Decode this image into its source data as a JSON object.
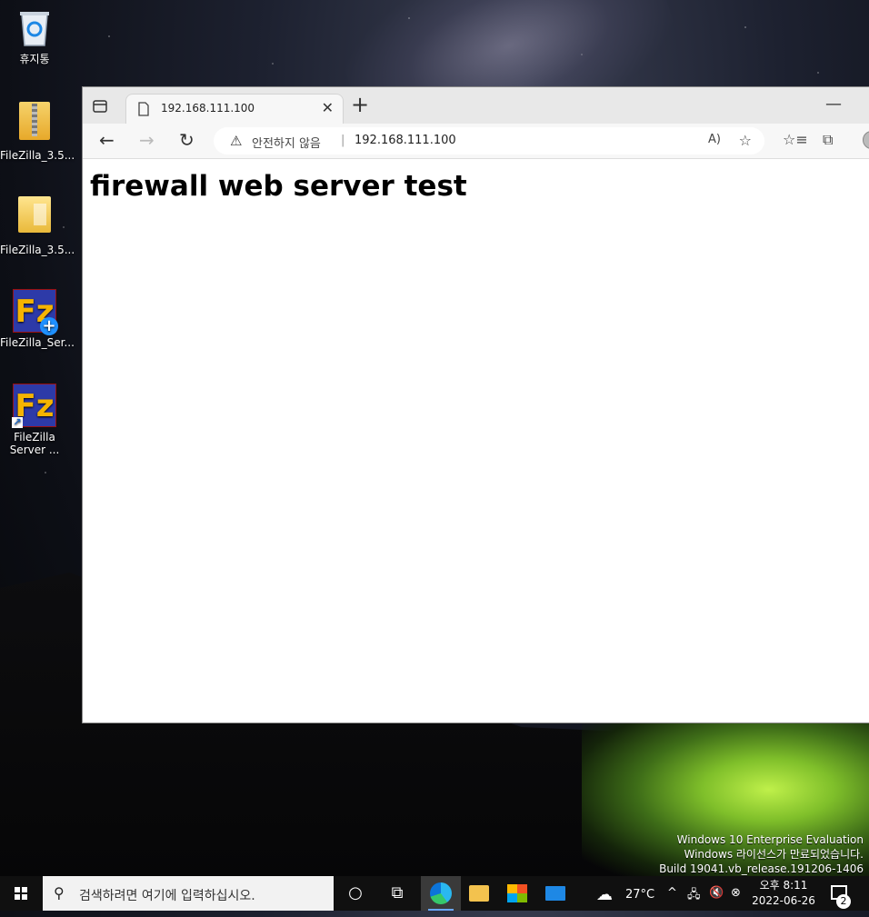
{
  "desktop": {
    "icons": [
      {
        "label": "휴지통",
        "icon": "recycle-bin-icon"
      },
      {
        "label": "FileZilla_3.5...",
        "icon": "zip-archive-icon"
      },
      {
        "label": "FileZilla_3.5...",
        "icon": "folder-icon"
      },
      {
        "label": "FileZilla_Ser...",
        "icon": "filezilla-installer-icon"
      },
      {
        "label": "FileZilla Server ...",
        "icon": "filezilla-server-icon"
      }
    ],
    "watermark": {
      "line1": "Windows 10 Enterprise Evaluation",
      "line2": "Windows 라이선스가 만료되었습니다.",
      "line3": "Build 19041.vb_release.191206-1406"
    }
  },
  "browser": {
    "tab": {
      "title": "192.168.111.100"
    },
    "address": {
      "security_text": "안전하지 않음",
      "url": "192.168.111.100"
    },
    "page": {
      "heading": "firewall web server test"
    }
  },
  "taskbar": {
    "search_placeholder": "검색하려면 여기에 입력하십시오.",
    "weather": "27°C",
    "clock": {
      "time": "오후 8:11",
      "date": "2022-06-26"
    },
    "notification_count": "2"
  }
}
